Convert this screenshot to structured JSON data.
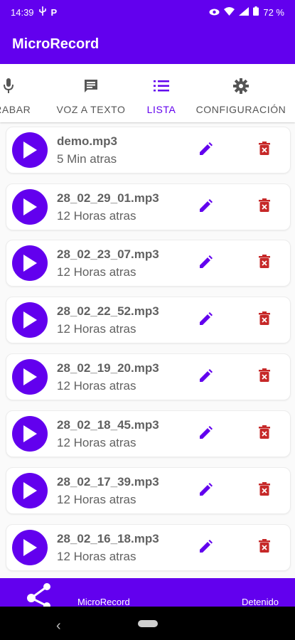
{
  "status_bar": {
    "time": "14:39",
    "battery": "72 %"
  },
  "app": {
    "title": "MicroRecord"
  },
  "tabs": [
    {
      "label": "GRABAR",
      "icon": "mic-icon",
      "active": false
    },
    {
      "label": "VOZ A TEXTO",
      "icon": "message-text-icon",
      "active": false
    },
    {
      "label": "LISTA",
      "icon": "list-icon",
      "active": true
    },
    {
      "label": "CONFIGURACIÓN",
      "icon": "gear-icon",
      "active": false
    }
  ],
  "recordings": [
    {
      "name": "demo.mp3",
      "time": "5 Min atras"
    },
    {
      "name": "28_02_29_01.mp3",
      "time": "12 Horas atras"
    },
    {
      "name": "28_02_23_07.mp3",
      "time": "12 Horas atras"
    },
    {
      "name": "28_02_22_52.mp3",
      "time": "12 Horas atras"
    },
    {
      "name": "28_02_19_20.mp3",
      "time": "12 Horas atras"
    },
    {
      "name": "28_02_18_45.mp3",
      "time": "12 Horas atras"
    },
    {
      "name": "28_02_17_39.mp3",
      "time": "12 Horas atras"
    },
    {
      "name": "28_02_16_18.mp3",
      "time": "12 Horas atras"
    }
  ],
  "bottom_bar": {
    "app_name": "MicroRecord",
    "status": "Detenido"
  },
  "colors": {
    "primary": "#6200ee",
    "delete": "#c62828",
    "text": "#616161"
  }
}
